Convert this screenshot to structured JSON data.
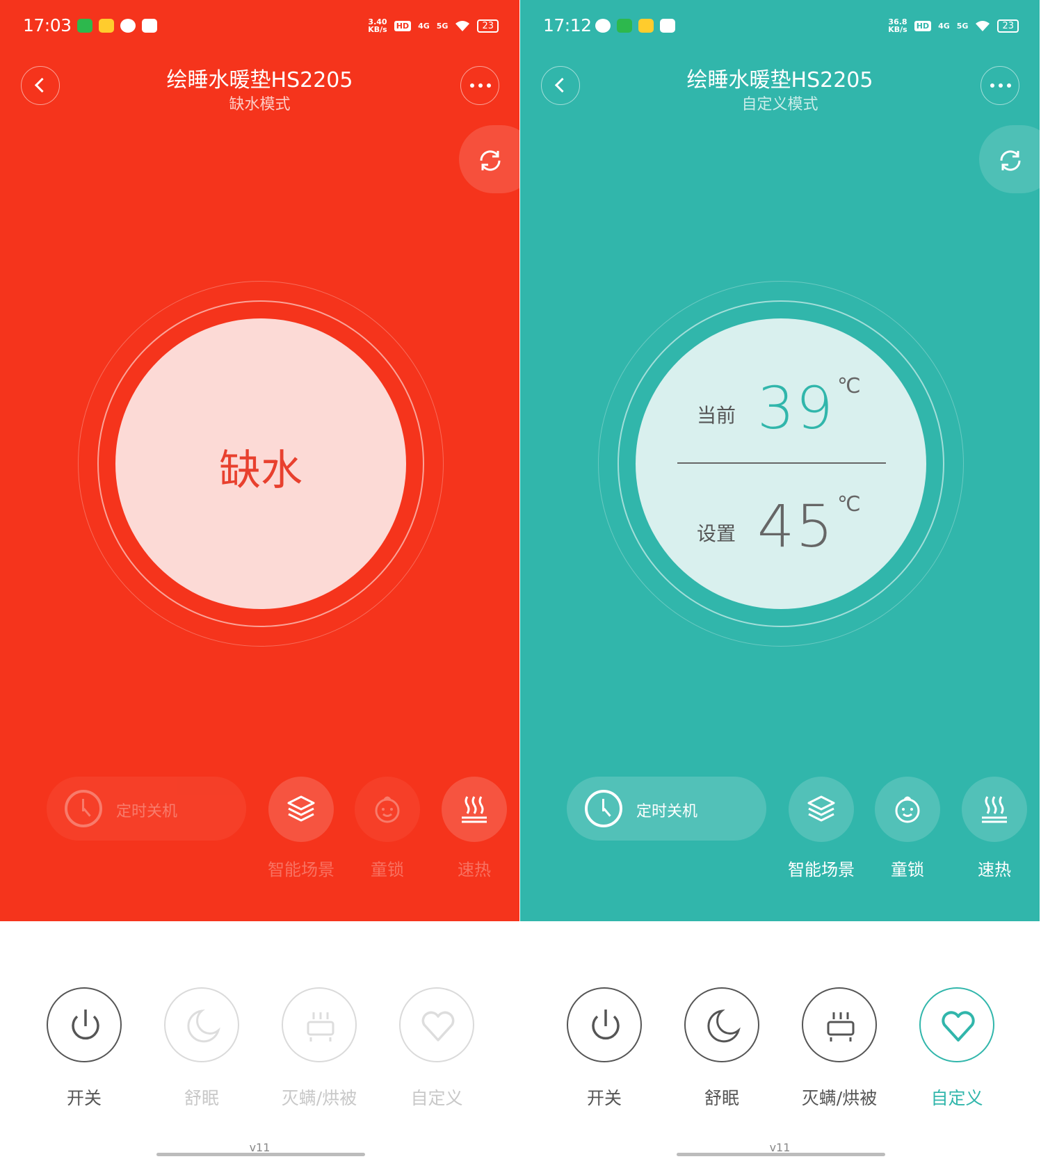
{
  "panels": [
    {
      "status": {
        "time": "17:03",
        "speed": "3.40",
        "speed_unit": "KB/s",
        "hd": "HD",
        "net1": "4G",
        "net2": "5G",
        "battery": "23"
      },
      "title": "绘睡水暖垫HS2205",
      "subtitle": "缺水模式",
      "accent": "#f5341c",
      "dial_text": "缺水",
      "timer_label": "定时关机",
      "controls": [
        {
          "icon": "layers-icon",
          "label": "智能场景"
        },
        {
          "icon": "child-face-icon",
          "label": "童锁"
        },
        {
          "icon": "heat-waves-icon",
          "label": "速热"
        }
      ],
      "modes": [
        {
          "icon": "power-icon",
          "label": "开关"
        },
        {
          "icon": "moon-sleep-icon",
          "label": "舒眠"
        },
        {
          "icon": "mite-bake-icon",
          "label": "灭螨/烘被"
        },
        {
          "icon": "heart-icon",
          "label": "自定义"
        }
      ],
      "version": "v11"
    },
    {
      "status": {
        "time": "17:12",
        "speed": "36.8",
        "speed_unit": "KB/s",
        "hd": "HD",
        "net1": "4G",
        "net2": "5G",
        "battery": "23"
      },
      "title": "绘睡水暖垫HS2205",
      "subtitle": "自定义模式",
      "accent": "#31b6ab",
      "current_label": "当前",
      "current_temp": "39",
      "set_label": "设置",
      "set_temp": "45",
      "unit": "℃",
      "timer_label": "定时关机",
      "controls": [
        {
          "icon": "layers-icon",
          "label": "智能场景"
        },
        {
          "icon": "child-face-icon",
          "label": "童锁"
        },
        {
          "icon": "heat-waves-icon",
          "label": "速热"
        }
      ],
      "modes": [
        {
          "icon": "power-icon",
          "label": "开关"
        },
        {
          "icon": "moon-sleep-icon",
          "label": "舒眠"
        },
        {
          "icon": "mite-bake-icon",
          "label": "灭螨/烘被"
        },
        {
          "icon": "heart-icon",
          "label": "自定义"
        }
      ],
      "version": "v11"
    }
  ]
}
